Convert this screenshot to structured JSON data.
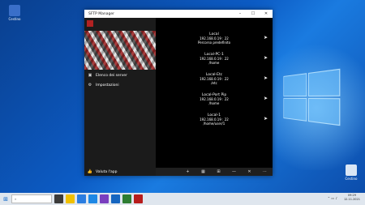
{
  "desktop": {
    "icons": [
      {
        "label": "Cestino",
        "color": "#3a6fc9"
      },
      {
        "label": "Cestino",
        "color": "#d9e6f5"
      }
    ]
  },
  "window": {
    "title": "SFTP Manager",
    "controls": {
      "minimize": "–",
      "maximize": "☐",
      "close": "✕"
    }
  },
  "nav": {
    "items": [
      {
        "label": "Elenco dei server",
        "icon": "server-list-icon",
        "glyph": "▣"
      },
      {
        "label": "Impostazioni",
        "icon": "gear-icon",
        "glyph": "⚙"
      }
    ],
    "footer": {
      "label": "Valuta l'app",
      "icon": "thumbs-up-icon",
      "glyph": "👍"
    }
  },
  "servers": [
    {
      "name": "Local",
      "host": "192.168.0.19 : 22",
      "path": "Percorso predefinito"
    },
    {
      "name": "Local-PC-1",
      "host": "192.168.0.19 : 22",
      "path": "/home"
    },
    {
      "name": "Local-Etc",
      "host": "192.168.0.19 : 22",
      "path": "/etc"
    },
    {
      "name": "Local-Port Pip",
      "host": "192.168.0.19 : 22",
      "path": "/home"
    },
    {
      "name": "Local-1",
      "host": "192.168.0.19 : 22",
      "path": "/home/user/1"
    }
  ],
  "commandbar": {
    "glyphs": [
      "+",
      "▦",
      "⊞",
      "—",
      "✕",
      "⋯"
    ]
  },
  "taskbar": {
    "search_text": "",
    "apps": [
      "#3b3b3b",
      "#f0c000",
      "#2a7de1",
      "#1e88e5",
      "#7a3fbf",
      "#1565c0",
      "#2e7d32",
      "#b71c1c"
    ],
    "time": "09:29",
    "date": "12.11.2021"
  }
}
